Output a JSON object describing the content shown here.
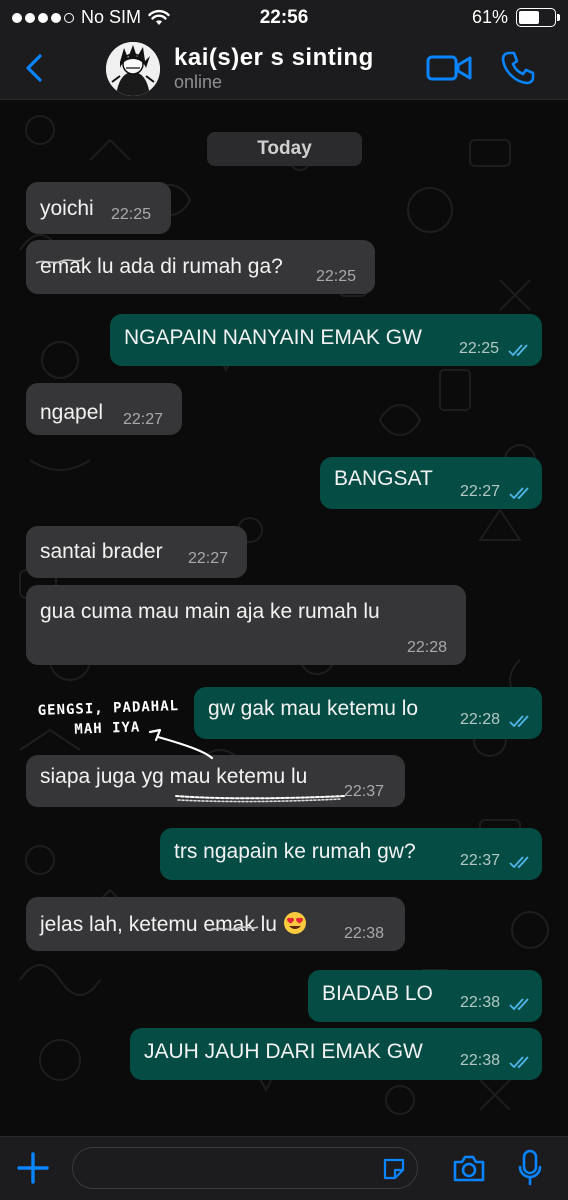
{
  "status_bar": {
    "carrier": "No SIM",
    "time": "22:56",
    "battery": "61%",
    "battery_level": 0.61,
    "signal_dots_filled": 4
  },
  "header": {
    "contact_name": "kai(s)er s sinting",
    "status": "online",
    "icons": [
      "back-chevron-icon",
      "video-call-icon",
      "phone-call-icon"
    ],
    "accent": "#0a84ff"
  },
  "chat": {
    "date_label": "Today",
    "colors": {
      "incoming": "#363638",
      "outgoing": "#054d44",
      "read_ticks": "#4fb6ec"
    },
    "messages": [
      {
        "dir": "in",
        "text": "yoichi",
        "time": "22:25"
      },
      {
        "dir": "in",
        "text": "emak lu ada di rumah ga?",
        "time": "22:25"
      },
      {
        "dir": "out",
        "text": "NGAPAIN NANYAIN EMAK GW",
        "time": "22:25"
      },
      {
        "dir": "in",
        "text": "ngapel",
        "time": "22:27"
      },
      {
        "dir": "out",
        "text": "BANGSAT",
        "time": "22:27"
      },
      {
        "dir": "in",
        "text": "santai brader",
        "time": "22:27"
      },
      {
        "dir": "in",
        "text": "gua cuma mau main aja ke rumah lu",
        "time": "22:28"
      },
      {
        "dir": "out",
        "text": "gw gak mau ketemu lo",
        "time": "22:28"
      },
      {
        "dir": "in",
        "text": "siapa juga yg mau ketemu lu",
        "time": "22:37"
      },
      {
        "dir": "out",
        "text": "trs ngapain ke rumah gw?",
        "time": "22:37"
      },
      {
        "dir": "in",
        "text": "jelas lah, ketemu emak lu",
        "emoji": "heart-eyes-emoji",
        "time": "22:38"
      },
      {
        "dir": "out",
        "text": "BIADAB LO",
        "time": "22:38"
      },
      {
        "dir": "out",
        "text": "JAUH JAUH DARI EMAK GW",
        "time": "22:38"
      }
    ],
    "annotation": {
      "line1": "GENGSI, PADAHAL",
      "line2": "MAH IYA"
    }
  },
  "input_bar": {
    "placeholder": "",
    "icons": [
      "plus-icon",
      "sticker-icon",
      "camera-icon",
      "microphone-icon"
    ]
  }
}
